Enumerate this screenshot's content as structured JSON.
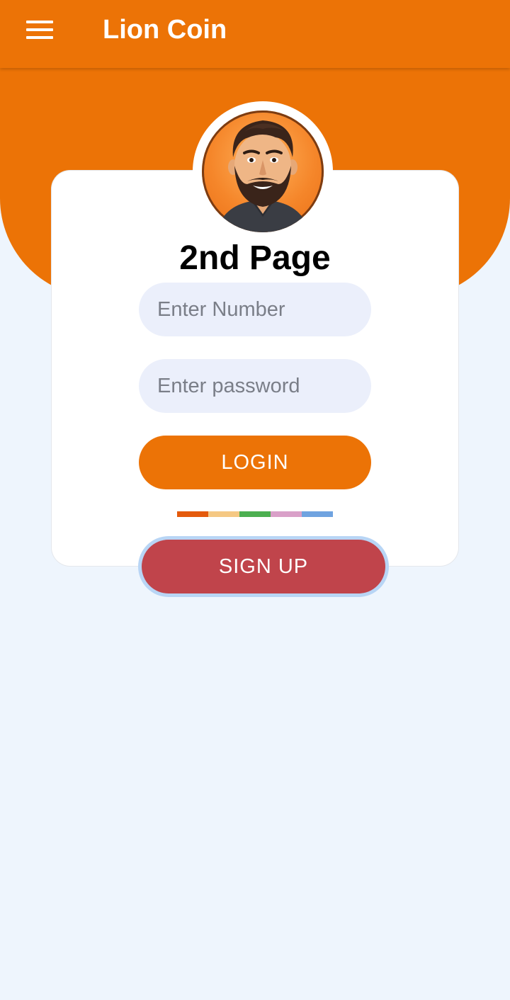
{
  "app_bar": {
    "title": "Lion Coin",
    "menu_icon": "hamburger-menu-icon"
  },
  "card": {
    "heading": "2nd Page",
    "avatar": "bearded-man-cartoon-avatar",
    "number_field": {
      "placeholder": "Enter Number",
      "value": ""
    },
    "password_field": {
      "placeholder": "Enter password",
      "value": ""
    },
    "login_label": "LOGIN",
    "signup_label": "SIGN UP",
    "divider_colors": [
      "#e45a0c",
      "#f5c883",
      "#4caf50",
      "#d9a0c8",
      "#6fa3e0"
    ]
  },
  "colors": {
    "primary": "#ec7306",
    "signup": "#c0444b",
    "field_bg": "#ebeffb",
    "page_bg": "#eef5fd"
  }
}
